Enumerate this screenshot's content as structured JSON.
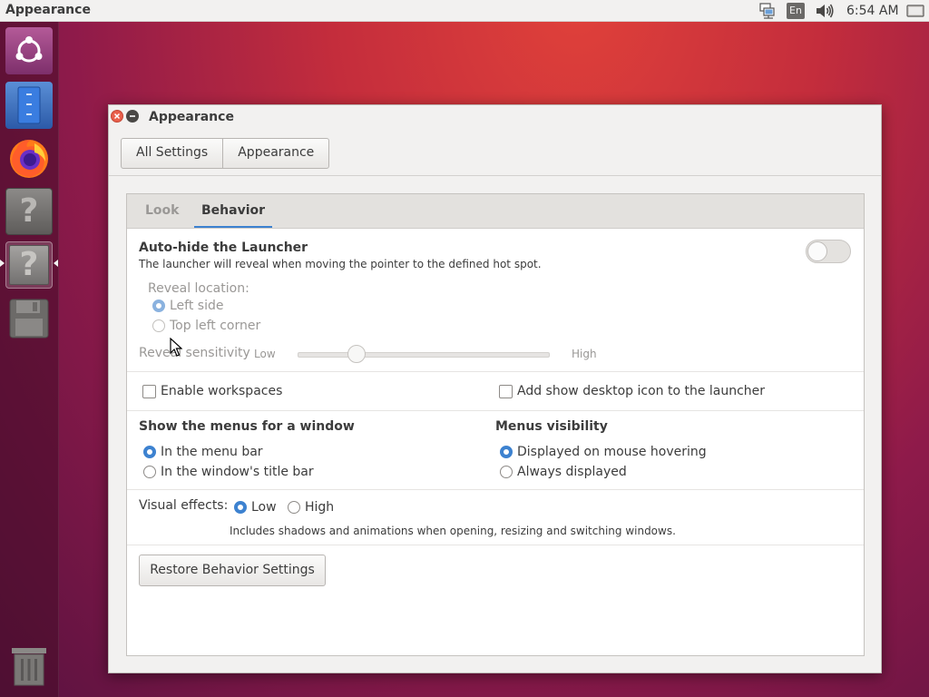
{
  "top_panel": {
    "app_title": "Appearance",
    "keyboard_layout": "En",
    "clock": "6:54 AM",
    "icons": [
      "network-icon",
      "keyboard-layout-icon",
      "volume-icon",
      "system-menu-icon"
    ]
  },
  "launcher": {
    "items": [
      {
        "name": "ubuntu-dash-icon"
      },
      {
        "name": "files-icon"
      },
      {
        "name": "firefox-icon"
      },
      {
        "name": "unknown-app-icon"
      },
      {
        "name": "appearance-app-icon",
        "active": true
      },
      {
        "name": "save-disk-icon"
      },
      {
        "name": "trash-icon"
      }
    ]
  },
  "window": {
    "title": "Appearance",
    "breadcrumbs": [
      "All Settings",
      "Appearance"
    ]
  },
  "tabs": [
    {
      "label": "Look",
      "selected": false
    },
    {
      "label": "Behavior",
      "selected": true
    }
  ],
  "behavior": {
    "autohide_title": "Auto-hide the Launcher",
    "autohide_desc": "The launcher will reveal when moving the pointer to the defined hot spot.",
    "autohide_enabled": false,
    "reveal_location_label": "Reveal location:",
    "reveal_left": "Left side",
    "reveal_topleft": "Top left corner",
    "reveal_selected": "Left side",
    "sensitivity_label": "Reveal sensitivity",
    "sensitivity_low": "Low",
    "sensitivity_high": "High",
    "enable_workspaces": "Enable workspaces",
    "show_desktop_icon": "Add show desktop icon to the launcher",
    "menus_window_title": "Show the menus for a window",
    "menus_in_menubar": "In the menu bar",
    "menus_in_titlebar": "In the window's title bar",
    "menus_visibility_title": "Menus visibility",
    "visibility_hover": "Displayed on mouse hovering",
    "visibility_always": "Always displayed",
    "visual_effects_label": "Visual effects:",
    "effects_low": "Low",
    "effects_high": "High",
    "effects_desc": "Includes shadows and animations when opening, resizing and switching windows.",
    "restore_button": "Restore Behavior Settings"
  },
  "colors": {
    "accent": "#3d82d0",
    "close_button": "#e95f4b",
    "tab_underline": "#3d82d0"
  }
}
